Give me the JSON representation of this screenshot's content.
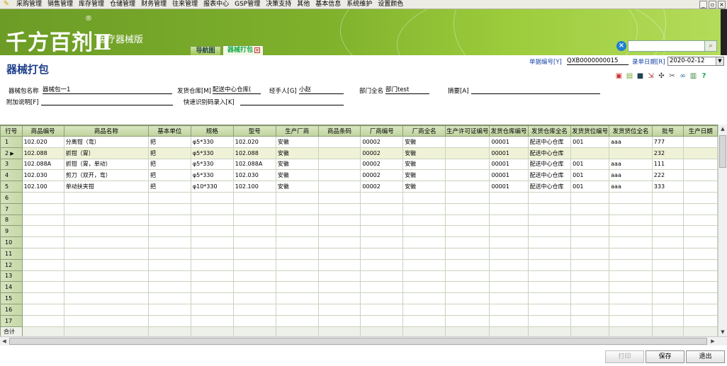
{
  "menu": [
    "采购管理",
    "销售管理",
    "库存管理",
    "仓储管理",
    "财务管理",
    "往来管理",
    "报表中心",
    "GSP管理",
    "决策支持",
    "其他",
    "基本信息",
    "系统维护",
    "设置颜色"
  ],
  "window_controls": [
    "_",
    "▫",
    "×"
  ],
  "brand": {
    "name": "千方百剂Ⅱ",
    "registered": "®",
    "edition": "医疗器械版"
  },
  "tabs": {
    "nav": "导航图",
    "active": "器械打包"
  },
  "page_title": "器械打包",
  "header": {
    "docno_label": "单据编号[Y]",
    "docno_value": "QXB0000000015",
    "date_label": "录单日期[R]",
    "date_value": "2020-02-12"
  },
  "toolbar_icons": [
    "print-preview-icon",
    "print-icon",
    "save-icon",
    "export-icon",
    "tools-icon",
    "cut-icon",
    "link-icon",
    "note-icon",
    "help-icon"
  ],
  "form": {
    "pack_name_label": "器械包名称",
    "pack_name_value": "器械包一1",
    "warehouse_label": "发货仓库[M]",
    "warehouse_value": "配送中心仓库(",
    "handler_label": "经手人[G]",
    "handler_value": "小赵",
    "dept_label": "部门全名",
    "dept_value": "部门test",
    "summary_label": "摘要[A]",
    "summary_value": "",
    "remark_label": "附加说明[F]",
    "remark_value": "",
    "quickcode_label": "快速识别码录入[K]",
    "quickcode_value": ""
  },
  "table": {
    "columns": [
      "行号",
      "商品编号",
      "商品名称",
      "基本单位",
      "规格",
      "型号",
      "生产厂商",
      "商品条码",
      "厂商编号",
      "厂商全名",
      "生产许可证编号",
      "发货仓库编号",
      "发货仓库全名",
      "发货货位编号",
      "发货货位全名",
      "批号",
      "生产日期"
    ],
    "rows": [
      [
        "1",
        "102.020",
        "分离钳（弯）",
        "把",
        "φ5*330",
        "102.020",
        "安徽",
        "",
        "00002",
        "安徽",
        "",
        "00001",
        "配送中心仓库",
        "001",
        "aaa",
        "777",
        ""
      ],
      [
        "2",
        "102.088",
        "抓钳（胃）",
        "把",
        "φ5*330",
        "102.088",
        "安徽",
        "",
        "00002",
        "安徽",
        "",
        "00001",
        "配送中心仓库",
        "",
        "",
        "232",
        ""
      ],
      [
        "3",
        "102.088A",
        "抓钳（胃，单动）",
        "把",
        "φ5*330",
        "102.088A",
        "安徽",
        "",
        "00002",
        "安徽",
        "",
        "00001",
        "配送中心仓库",
        "001",
        "aaa",
        "111",
        ""
      ],
      [
        "4",
        "102.030",
        "剪刀（双开，弯）",
        "把",
        "φ5*330",
        "102.030",
        "安徽",
        "",
        "00002",
        "安徽",
        "",
        "00001",
        "配送中心仓库",
        "001",
        "aaa",
        "222",
        ""
      ],
      [
        "5",
        "102.100",
        "单动扶夹钳",
        "把",
        "φ10*330",
        "102.100",
        "安徽",
        "",
        "00002",
        "安徽",
        "",
        "00001",
        "配送中心仓库",
        "001",
        "aaa",
        "333",
        ""
      ],
      [
        "6",
        "",
        "",
        "",
        "",
        "",
        "",
        "",
        "",
        "",
        "",
        "",
        "",
        "",
        "",
        "",
        ""
      ],
      [
        "7",
        "",
        "",
        "",
        "",
        "",
        "",
        "",
        "",
        "",
        "",
        "",
        "",
        "",
        "",
        "",
        ""
      ],
      [
        "8",
        "",
        "",
        "",
        "",
        "",
        "",
        "",
        "",
        "",
        "",
        "",
        "",
        "",
        "",
        "",
        ""
      ],
      [
        "9",
        "",
        "",
        "",
        "",
        "",
        "",
        "",
        "",
        "",
        "",
        "",
        "",
        "",
        "",
        "",
        ""
      ],
      [
        "10",
        "",
        "",
        "",
        "",
        "",
        "",
        "",
        "",
        "",
        "",
        "",
        "",
        "",
        "",
        "",
        ""
      ],
      [
        "11",
        "",
        "",
        "",
        "",
        "",
        "",
        "",
        "",
        "",
        "",
        "",
        "",
        "",
        "",
        "",
        ""
      ],
      [
        "12",
        "",
        "",
        "",
        "",
        "",
        "",
        "",
        "",
        "",
        "",
        "",
        "",
        "",
        "",
        "",
        ""
      ],
      [
        "13",
        "",
        "",
        "",
        "",
        "",
        "",
        "",
        "",
        "",
        "",
        "",
        "",
        "",
        "",
        "",
        ""
      ],
      [
        "14",
        "",
        "",
        "",
        "",
        "",
        "",
        "",
        "",
        "",
        "",
        "",
        "",
        "",
        "",
        "",
        ""
      ],
      [
        "15",
        "",
        "",
        "",
        "",
        "",
        "",
        "",
        "",
        "",
        "",
        "",
        "",
        "",
        "",
        "",
        ""
      ],
      [
        "16",
        "",
        "",
        "",
        "",
        "",
        "",
        "",
        "",
        "",
        "",
        "",
        "",
        "",
        "",
        "",
        ""
      ],
      [
        "17",
        "",
        "",
        "",
        "",
        "",
        "",
        "",
        "",
        "",
        "",
        "",
        "",
        "",
        "",
        "",
        ""
      ]
    ],
    "selected_row": 2,
    "total_label": "合计"
  },
  "buttons": {
    "print": "打印",
    "save": "保存",
    "exit": "退出"
  }
}
